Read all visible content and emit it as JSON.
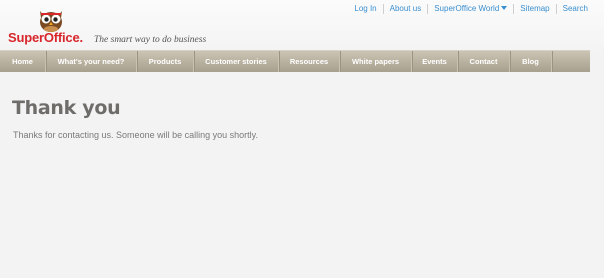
{
  "header": {
    "brand": "SuperOffice.",
    "tagline": "The smart way to do business",
    "top_links": [
      {
        "label": "Log In"
      },
      {
        "label": "About us"
      },
      {
        "label": "SuperOffice World"
      },
      {
        "label": "Sitemap"
      },
      {
        "label": "Search"
      }
    ]
  },
  "nav": {
    "items": [
      {
        "label": "Home"
      },
      {
        "label": "What's your need?"
      },
      {
        "label": "Products"
      },
      {
        "label": "Customer stories"
      },
      {
        "label": "Resources"
      },
      {
        "label": "White papers"
      },
      {
        "label": "Events"
      },
      {
        "label": "Contact"
      },
      {
        "label": "Blog"
      }
    ]
  },
  "main": {
    "title": "Thank you",
    "message": "Thanks for contacting us. Someone will be calling you shortly."
  },
  "colors": {
    "brand_red": "#d8262b",
    "link_blue": "#3a8fd0",
    "nav_bg": "#b7af9d"
  },
  "icons": {
    "logo": "owl-logo-icon",
    "world_menu": "caret-down-icon"
  }
}
